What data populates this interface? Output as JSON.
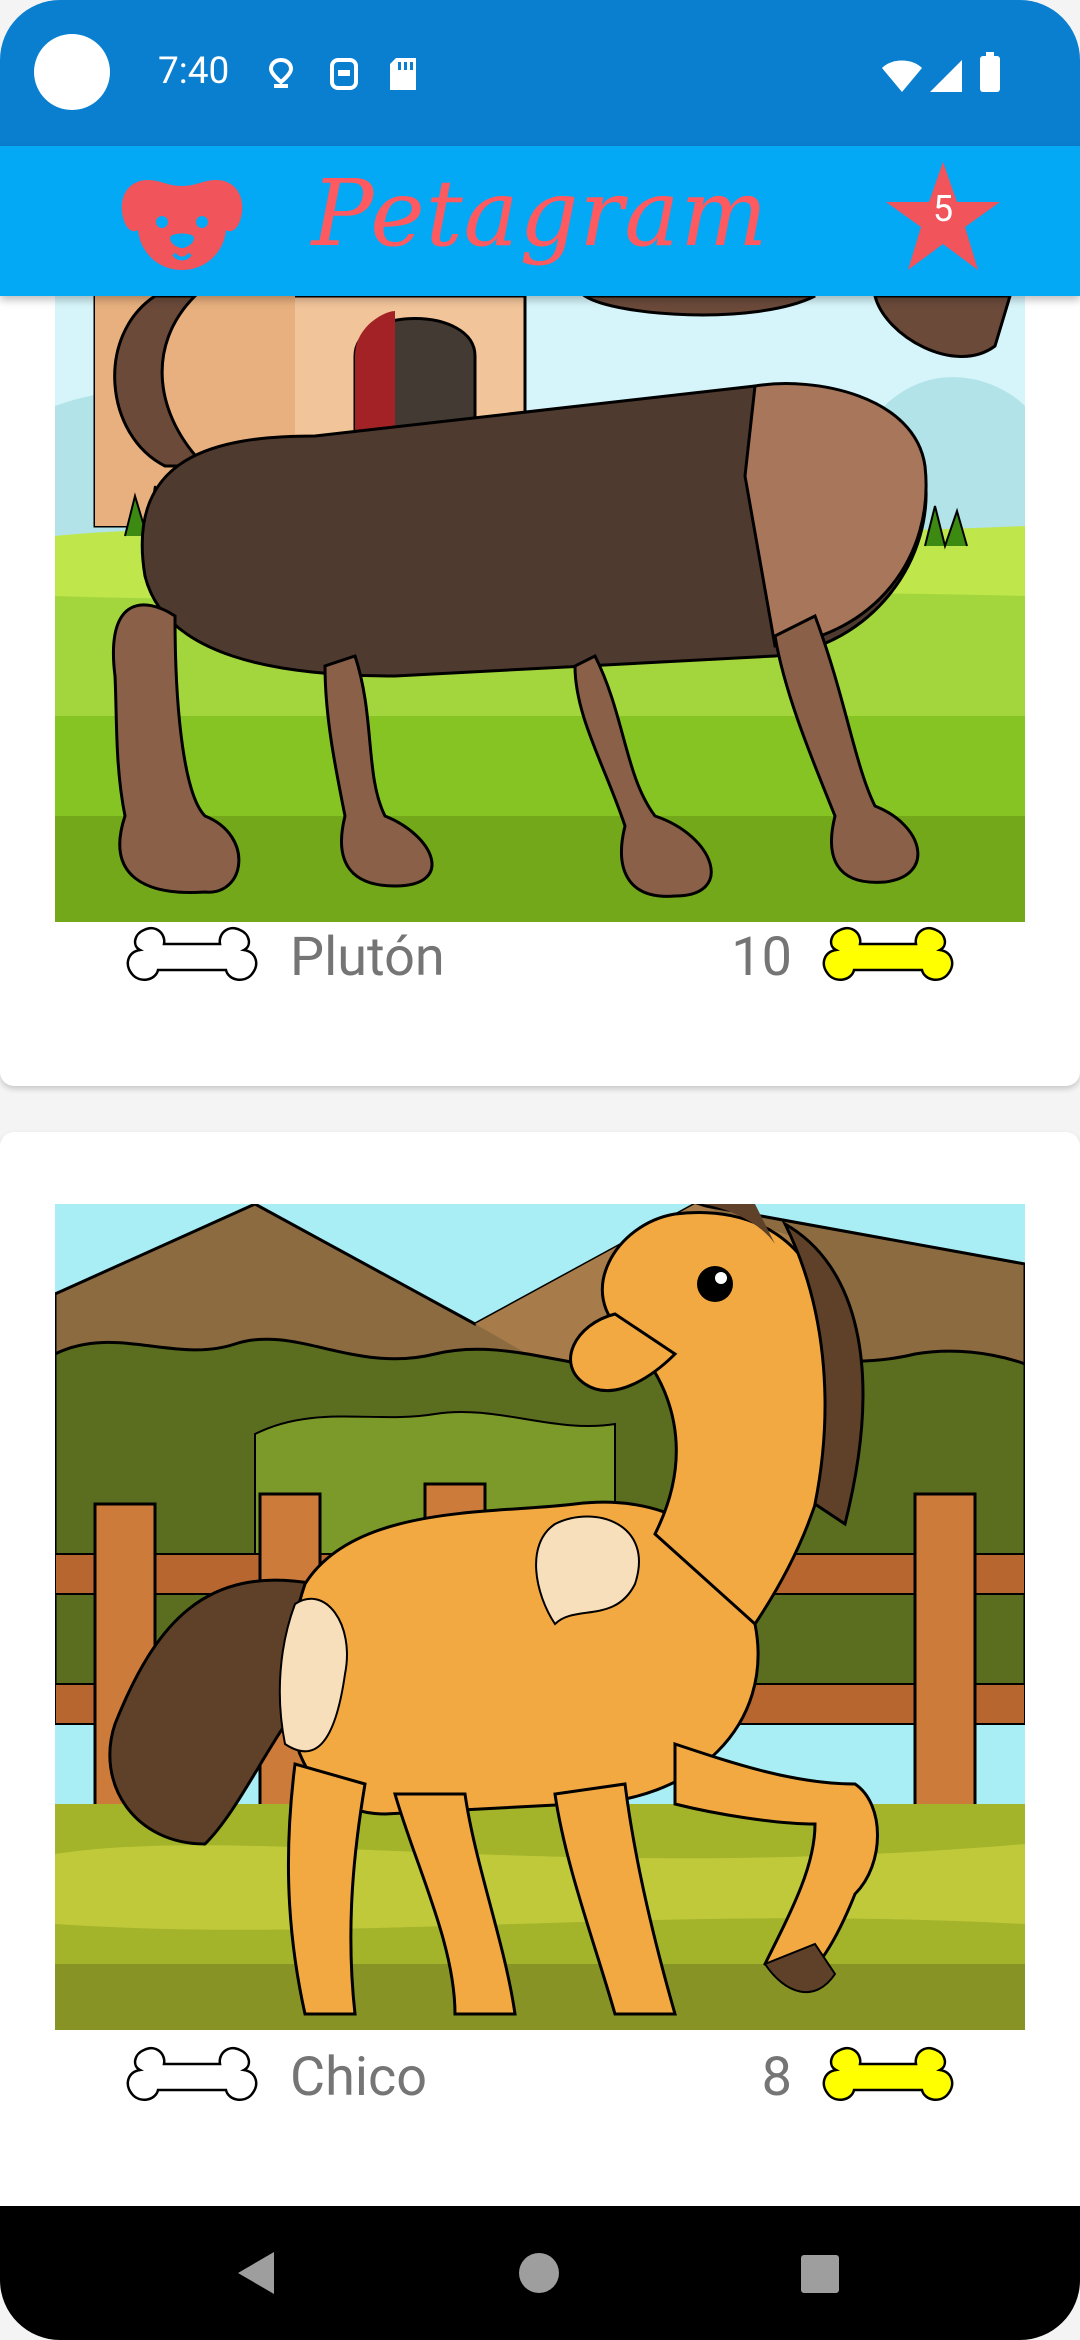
{
  "status_bar": {
    "time": "7:40",
    "left_icons": [
      "circle-indicator",
      "location-pin-icon",
      "sim-icon",
      "sd-card-icon"
    ],
    "right_icons": [
      "wifi-icon",
      "cellular-signal-icon",
      "battery-icon"
    ]
  },
  "app_bar": {
    "title": "Petagram",
    "left_icon": "dog-face-icon",
    "favorites_badge": "5",
    "title_color": "#ff5a5f",
    "background_color": "#03a9f4"
  },
  "pets": [
    {
      "name": "Plutón",
      "likes": "10",
      "image": "dachshund-illustration"
    },
    {
      "name": "Chico",
      "likes": "8",
      "image": "pony-illustration"
    }
  ],
  "nav_bar": {
    "buttons": [
      "back-triangle-icon",
      "home-circle-icon",
      "recents-square-icon"
    ]
  }
}
